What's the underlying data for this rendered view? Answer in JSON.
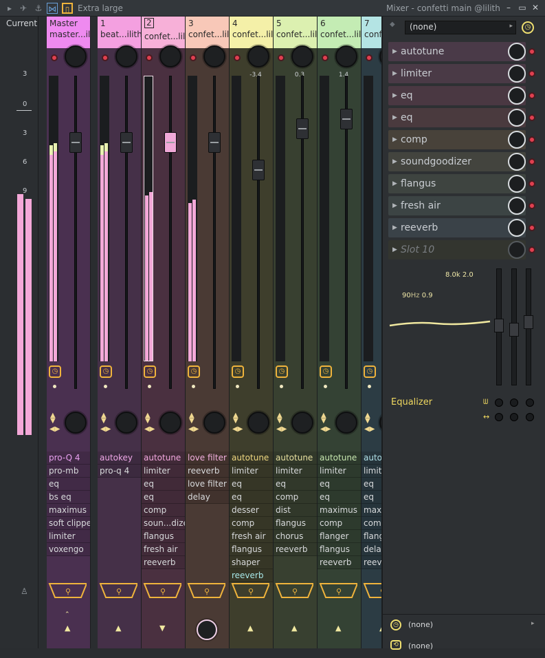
{
  "topbar": {
    "size_label": "Extra large",
    "window_title": "Mixer - confetti main @lilith"
  },
  "meter_strip": {
    "current_label": "Current",
    "db_labels": [
      "3",
      "0",
      "3",
      "6",
      "9"
    ]
  },
  "strips": [
    {
      "num": "Master",
      "name": "master...ilith",
      "color": "#ef8af0",
      "body": "#4a3050",
      "pan_value": "",
      "fx": [
        "pro-Q 4",
        "pro-mb",
        "eq",
        "bs eq",
        "maximus",
        "soft clipper",
        "limiter",
        "voxengo"
      ],
      "fx_first_color": "#e9a0f0"
    },
    {
      "num": "1",
      "name": "beat...ilith",
      "color": "#f4a0e0",
      "body": "#453048",
      "pan_value": "",
      "fx": [
        "autokey",
        "pro-q 4"
      ],
      "fx_first_color": "#f0a8e8"
    },
    {
      "num": "2",
      "name": "confet...lilith",
      "color": "#f7b0d8",
      "body": "#4a3040",
      "pan_value": "",
      "fx": [
        "autotune",
        "limiter",
        "eq",
        "eq",
        "comp",
        "soun...dizer",
        "flangus",
        "fresh air",
        "reeverb"
      ],
      "fx_first_color": "#f4a8e0"
    },
    {
      "num": "3",
      "name": "confet...lilith",
      "color": "#f8c8b8",
      "body": "#4a3a34",
      "pan_value": "",
      "fx": [
        "love filter",
        "reeverb",
        "love filter",
        "delay"
      ],
      "fx_first_color": "#f4b0e0"
    },
    {
      "num": "4",
      "name": "confet...lilith",
      "color": "#f4f0a8",
      "body": "#3e3e2c",
      "pan_value": "-3.4",
      "fx": [
        "autotune",
        "limiter",
        "eq",
        "eq",
        "desser",
        "comp",
        "fresh air",
        "flangus",
        "shaper",
        "reeverb"
      ],
      "fx_first_color": "#f0d880"
    },
    {
      "num": "5",
      "name": "confet...lilith",
      "color": "#dcf0b0",
      "body": "#384030",
      "pan_value": "0.3",
      "fx": [
        "autotune",
        "limiter",
        "eq",
        "comp",
        "dist",
        "flangus",
        "chorus",
        "reeverb"
      ],
      "fx_first_color": "#e8e0a0"
    },
    {
      "num": "6",
      "name": "confet...lilith",
      "color": "#c4ecb4",
      "body": "#344234",
      "pan_value": "1.4",
      "fx": [
        "autotune",
        "limiter",
        "eq",
        "eq",
        "maximus",
        "comp",
        "flanger",
        "flangus",
        "reeverb"
      ],
      "fx_first_color": "#c8e8b0"
    },
    {
      "num": "7",
      "name": "confet...lilith",
      "color": "#b4e4e4",
      "body": "#2c3c44",
      "pan_value": "",
      "fx": [
        "autotune",
        "limiter",
        "eq",
        "eq",
        "maximus",
        "comp",
        "flangus",
        "delay",
        "reeverb"
      ],
      "fx_first_color": "#b0e0e8"
    }
  ],
  "right_panel": {
    "preset": "(none)",
    "slots": [
      {
        "name": "autotune",
        "bg": "#4a3a48"
      },
      {
        "name": "limiter",
        "bg": "#4a3a46"
      },
      {
        "name": "eq",
        "bg": "#4a3842"
      },
      {
        "name": "eq",
        "bg": "#4a3a3e"
      },
      {
        "name": "comp",
        "bg": "#48423a"
      },
      {
        "name": "soundgoodizer",
        "bg": "#43443e"
      },
      {
        "name": "flangus",
        "bg": "#3e4440"
      },
      {
        "name": "fresh air",
        "bg": "#3c4444"
      },
      {
        "name": "reeverb",
        "bg": "#3a4248"
      },
      {
        "name": "Slot 10",
        "bg": "#33352f"
      }
    ],
    "eq": {
      "label": "Equalizer",
      "band_hi": "8.0k",
      "band_hi_q": "2.0",
      "band_lo": "90",
      "band_lo_unit": "Hz",
      "band_lo_q": "0.9"
    },
    "bottom_1": "(none)",
    "bottom_2": "(none)"
  },
  "colors": {
    "accent": "#f0b43c",
    "meter": "#f4a8d8",
    "led": "#e04050"
  }
}
